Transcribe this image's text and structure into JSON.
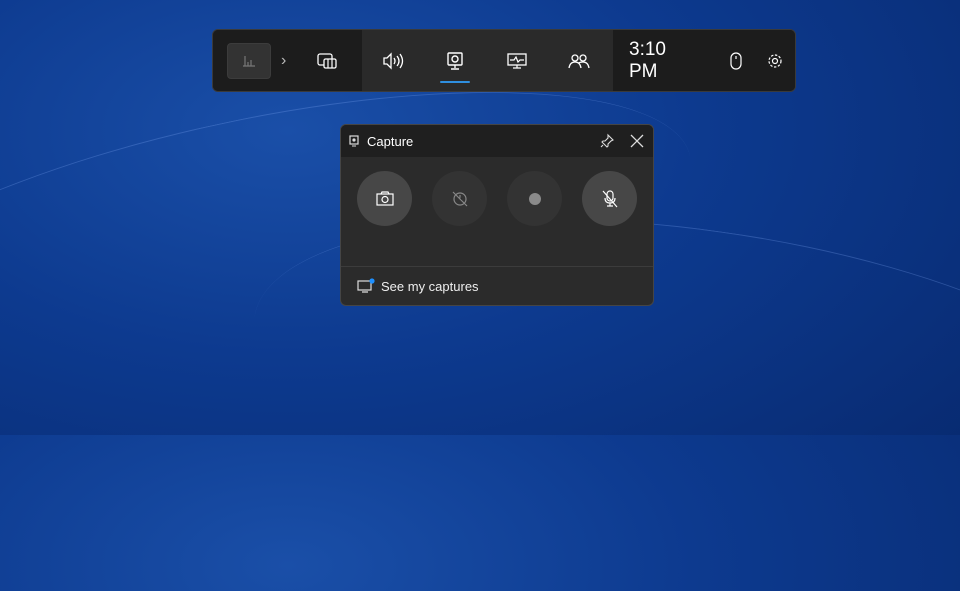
{
  "gamebar": {
    "time": "3:10 PM",
    "buttons": [
      {
        "icon": "widget-menu-icon"
      },
      {
        "icon": "performance-icon"
      },
      {
        "icon": "audio-icon"
      },
      {
        "icon": "capture-icon",
        "active": true
      },
      {
        "icon": "resources-icon"
      },
      {
        "icon": "xbox-social-icon"
      }
    ],
    "accent": "#2f8fe0"
  },
  "capture": {
    "title": "Capture",
    "footer_link": "See my captures",
    "notification_dot": "#1e90ff"
  }
}
